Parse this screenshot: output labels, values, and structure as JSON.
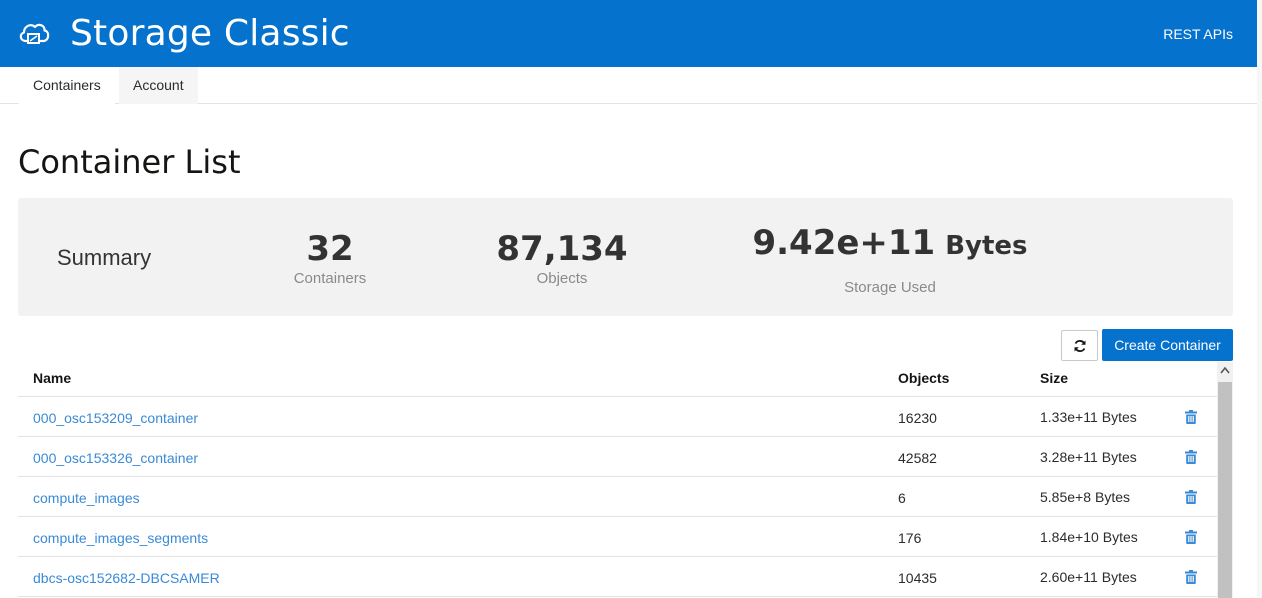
{
  "header": {
    "app_title": "Storage Classic",
    "rest_link": "REST APIs",
    "logo_icon": "cloud-storage-icon",
    "brand_color": "#0572ce"
  },
  "tabs": [
    {
      "label": "Containers",
      "active": true
    },
    {
      "label": "Account",
      "active": false
    }
  ],
  "page": {
    "title": "Container List"
  },
  "summary": {
    "label": "Summary",
    "containers_value": "32",
    "containers_caption": "Containers",
    "objects_value": "87,134",
    "objects_caption": "Objects",
    "storage_value": "9.42e+11",
    "storage_unit": "Bytes",
    "storage_caption": "Storage Used"
  },
  "toolbar": {
    "refresh_icon": "refresh-icon",
    "create_label": "Create Container"
  },
  "table": {
    "headers": {
      "name": "Name",
      "objects": "Objects",
      "size": "Size"
    },
    "rows": [
      {
        "name": "000_osc153209_container",
        "objects": "16230",
        "size": "1.33e+11",
        "unit": "Bytes"
      },
      {
        "name": "000_osc153326_container",
        "objects": "42582",
        "size": "3.28e+11",
        "unit": "Bytes"
      },
      {
        "name": "compute_images",
        "objects": "6",
        "size": "5.85e+8",
        "unit": "Bytes"
      },
      {
        "name": "compute_images_segments",
        "objects": "176",
        "size": "1.84e+10",
        "unit": "Bytes"
      },
      {
        "name": "dbcs-osc152682-DBCSAMER",
        "objects": "10435",
        "size": "2.60e+11",
        "unit": "Bytes"
      }
    ]
  }
}
